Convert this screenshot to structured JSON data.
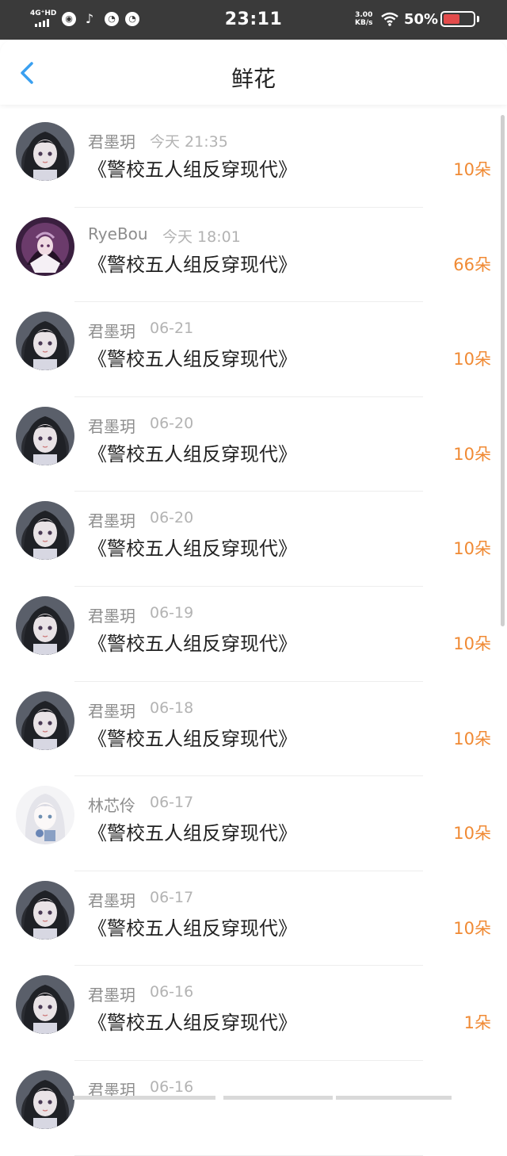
{
  "status_bar": {
    "network": "4G⁺HD",
    "time": "23:11",
    "speed_value": "3.00",
    "speed_unit": "KB/s",
    "battery": "50%"
  },
  "header": {
    "title": "鲜花",
    "back_icon": "chevron-left-icon"
  },
  "colors": {
    "accent_blue": "#3aa0f0",
    "count_orange": "#f08a34",
    "status_bg": "#3a3a3a"
  },
  "list": [
    {
      "user": "君墨玥",
      "time": "今天 21:35",
      "book": "《警校五人组反穿现代》",
      "count": "10朵",
      "avatar": "dark-hair-girl"
    },
    {
      "user": "RyeBou",
      "time": "今天 18:01",
      "book": "《警校五人组反穿现代》",
      "count": "66朵",
      "avatar": "purple-maid-girl"
    },
    {
      "user": "君墨玥",
      "time": "06-21",
      "book": "《警校五人组反穿现代》",
      "count": "10朵",
      "avatar": "dark-hair-girl"
    },
    {
      "user": "君墨玥",
      "time": "06-20",
      "book": "《警校五人组反穿现代》",
      "count": "10朵",
      "avatar": "dark-hair-girl"
    },
    {
      "user": "君墨玥",
      "time": "06-20",
      "book": "《警校五人组反穿现代》",
      "count": "10朵",
      "avatar": "dark-hair-girl"
    },
    {
      "user": "君墨玥",
      "time": "06-19",
      "book": "《警校五人组反穿现代》",
      "count": "10朵",
      "avatar": "dark-hair-girl"
    },
    {
      "user": "君墨玥",
      "time": "06-18",
      "book": "《警校五人组反穿现代》",
      "count": "10朵",
      "avatar": "dark-hair-girl"
    },
    {
      "user": "林芯伶",
      "time": "06-17",
      "book": "《警校五人组反穿现代》",
      "count": "10朵",
      "avatar": "white-hair-girl"
    },
    {
      "user": "君墨玥",
      "time": "06-17",
      "book": "《警校五人组反穿现代》",
      "count": "10朵",
      "avatar": "dark-hair-girl"
    },
    {
      "user": "君墨玥",
      "time": "06-16",
      "book": "《警校五人组反穿现代》",
      "count": "1朵",
      "avatar": "dark-hair-girl"
    },
    {
      "user": "君墨玥",
      "time": "06-16",
      "book": "",
      "count": "",
      "avatar": "dark-hair-girl"
    }
  ]
}
